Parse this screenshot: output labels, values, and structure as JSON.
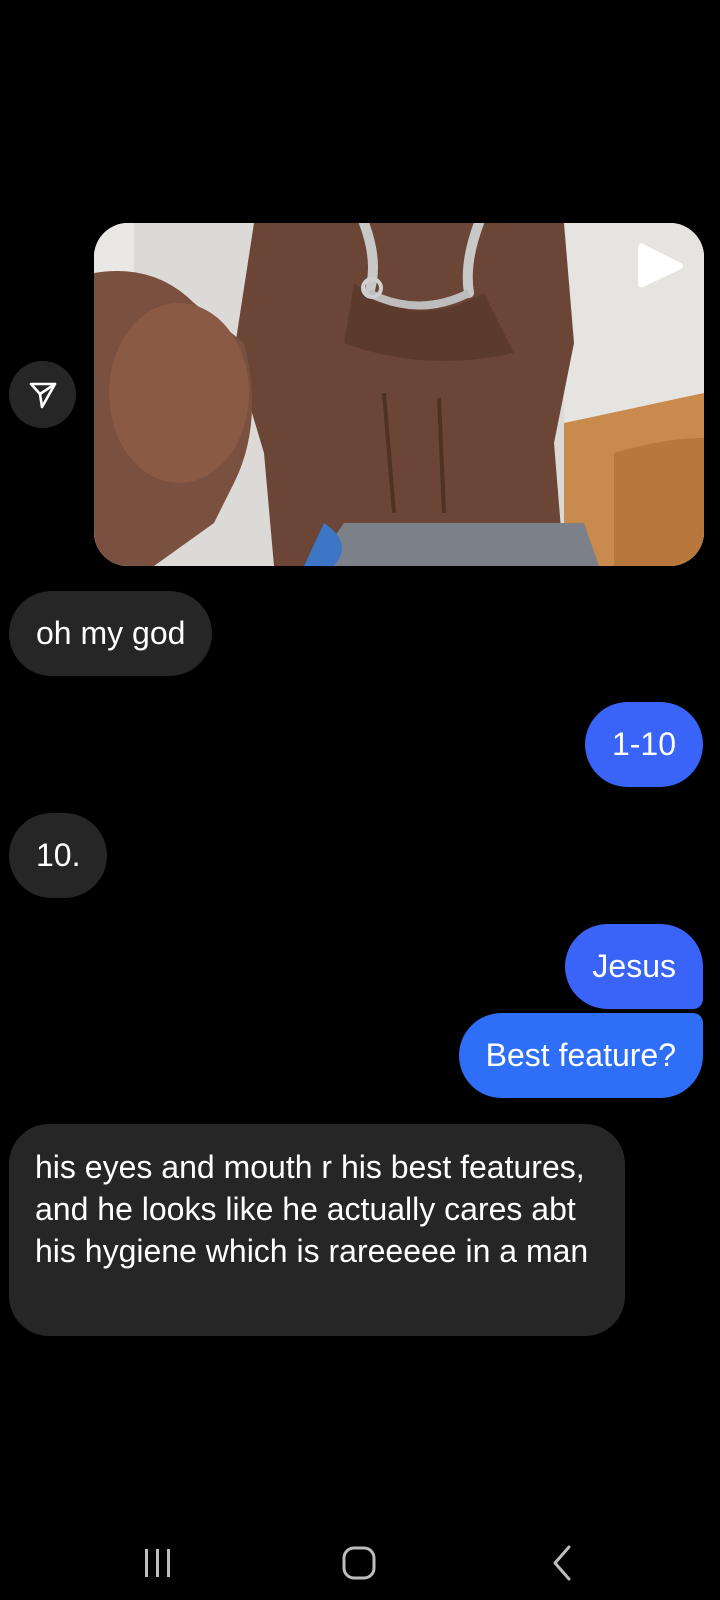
{
  "icons": {
    "share": "paper-plane-icon",
    "play": "play-icon",
    "recent_apps": "recent-apps-icon",
    "home": "home-icon",
    "back": "back-icon"
  },
  "colors": {
    "background": "#000000",
    "incoming_bubble": "#262626",
    "outgoing_bubble": "#3a63f7"
  },
  "messages": [
    {
      "direction": "incoming",
      "text": "oh my god"
    },
    {
      "direction": "outgoing",
      "text": "1-10"
    },
    {
      "direction": "incoming",
      "text": "10."
    },
    {
      "direction": "outgoing",
      "text": "Jesus"
    },
    {
      "direction": "outgoing",
      "text": "Best feature?"
    },
    {
      "direction": "incoming",
      "text": "his eyes and mouth r his best features, and he looks like he actually cares abt his hygiene which is rareeeee in a man"
    }
  ]
}
